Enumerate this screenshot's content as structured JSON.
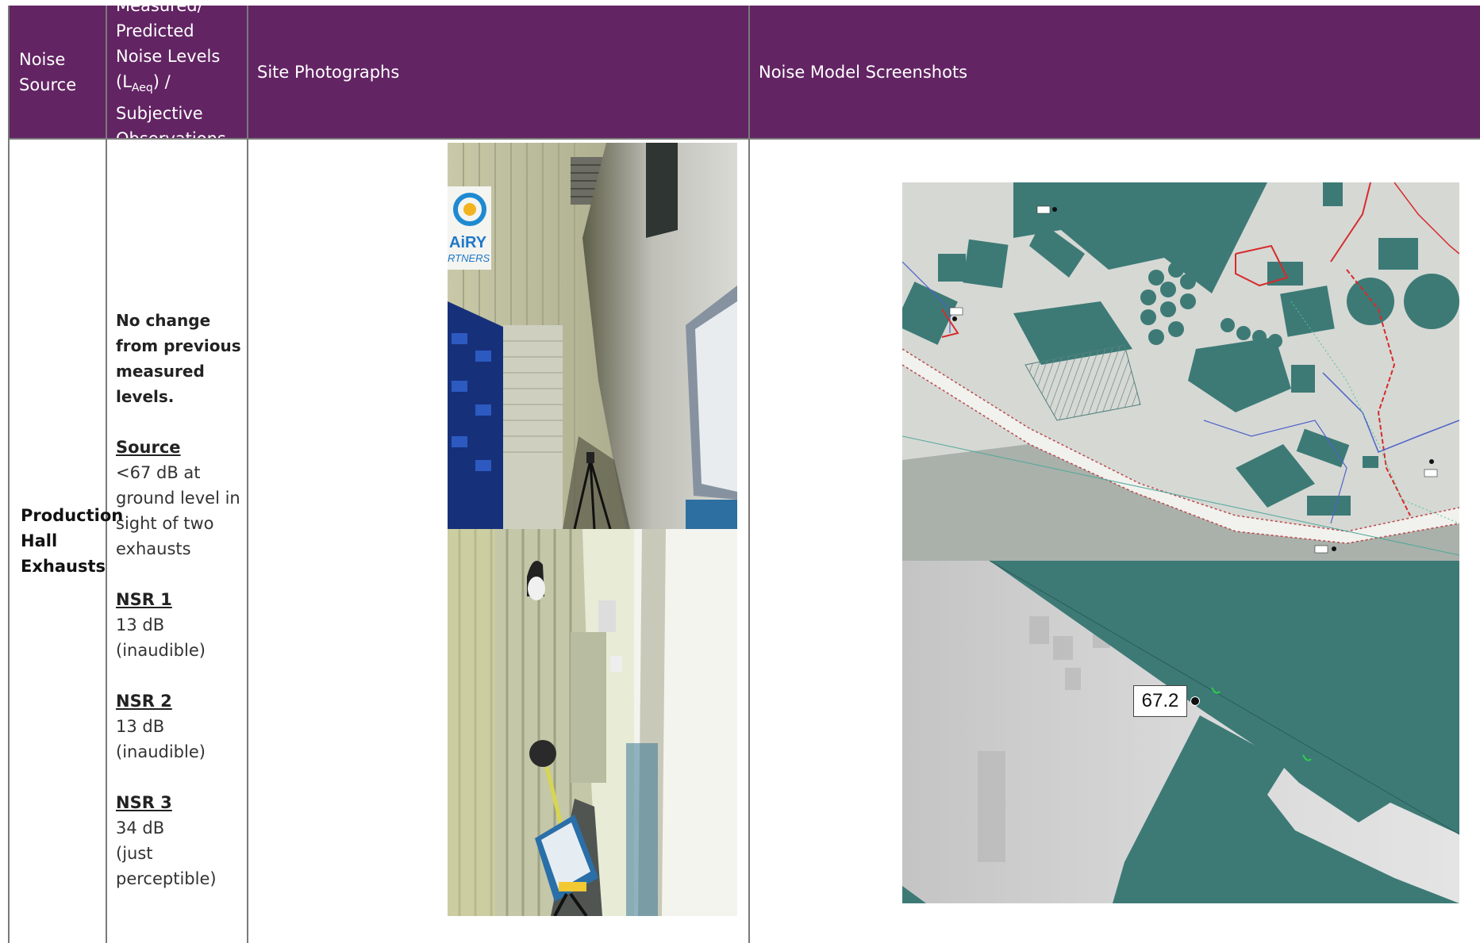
{
  "header": {
    "col1": "Noise Source",
    "col2_lines": [
      "Measured/",
      "Predicted",
      "Noise Levels",
      "(L",
      "Aeq",
      ") / Subjective",
      "Observations"
    ],
    "col3": "Site Photographs",
    "col4": "Noise Model Screenshots"
  },
  "row": {
    "source": "Production Hall Exhausts",
    "lead": "No change from previous measured levels.",
    "blocks": [
      {
        "heading": "Source",
        "text": "<67 dB at ground level in sight of two exhausts"
      },
      {
        "heading": "NSR 1",
        "text": "13 dB (inaudible)"
      },
      {
        "heading": "NSR 2",
        "text": "13 dB (inaudible)"
      },
      {
        "heading": "NSR 3",
        "text": "34 dB",
        "text2": "(just perceptible)"
      }
    ],
    "photo_sign_text": "AiRY RTNERS",
    "model_label": "67.2"
  },
  "colors": {
    "header_bg": "#622463",
    "building_teal": "#3d7a76",
    "boundary_red": "#d62b2b",
    "boundary_blue": "#4d63c9"
  }
}
